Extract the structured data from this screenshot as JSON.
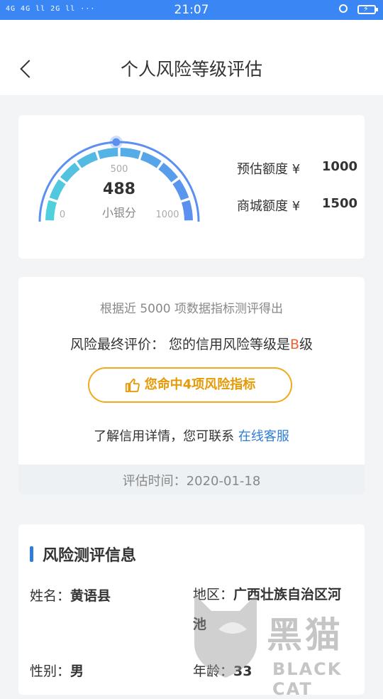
{
  "status_bar": {
    "signal_text": "4G 4G ll 2G ll ···",
    "time": "21:07",
    "icons": [
      "alarm-icon",
      "battery-charging-icon"
    ]
  },
  "header": {
    "title": "个人风险等级评估",
    "back_icon": "chevron-left-icon"
  },
  "score_card": {
    "score": "488",
    "unit": "小银分",
    "tick_min": "0",
    "tick_mid": "500",
    "tick_max": "1000",
    "gauge_value": 488,
    "gauge_range": [
      0,
      1000
    ],
    "estimated_label": "预估额度 ¥",
    "estimated_amount": "1000",
    "mall_label": "商城额度 ¥",
    "mall_amount": "1500"
  },
  "evaluation": {
    "basis_text": "根据近 5000 项数据指标测评得出",
    "final_prefix": "风险最终评价： 您的信用风险等级是",
    "grade": "B",
    "final_suffix": "级",
    "hit_button": "您命中4项风险指标",
    "contact_prefix": "了解信用详情，您可联系 ",
    "contact_link": "在线客服",
    "time_text": "评估时间：2020-01-18"
  },
  "info": {
    "title": "风险测评信息",
    "name_label": "姓名：",
    "name_value": "黄语县",
    "region_label": "地区：",
    "region_value": "广西壮族自治区河池",
    "gender_label": "性别：",
    "gender_value": "男",
    "age_label": "年龄：",
    "age_value": "33"
  },
  "watermark": {
    "text": "黑猫",
    "sub": "BLACK CAT"
  },
  "colors": {
    "status_bar": "#3b86f5",
    "gauge_inner": "#4fd0dc",
    "gauge_outer": "#5b8ff0",
    "accent_link": "#2e7ed8",
    "grade": "#f0612f",
    "pill": "#f2a91c"
  }
}
